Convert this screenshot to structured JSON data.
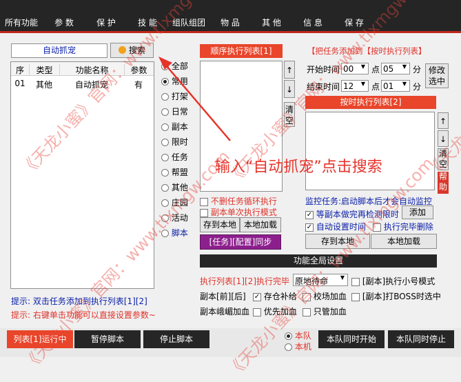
{
  "nav": {
    "tabs": [
      "所有功能",
      "参 数",
      "保 护",
      "技 能",
      "组队组团",
      "物 品",
      "其 他",
      "信 息",
      "保 存"
    ],
    "active_index": 0
  },
  "search": {
    "value": "自动抓宠",
    "button_label": "搜索"
  },
  "table": {
    "headers": [
      "序",
      "类型",
      "功能名称",
      "参数"
    ],
    "rows": [
      [
        "01",
        "其他",
        "自动抓宠",
        "有"
      ]
    ]
  },
  "categories": [
    "全部",
    "常用",
    "打架",
    "日常",
    "副本",
    "限时",
    "任务",
    "帮盟",
    "其他",
    "庄园",
    "活动",
    "脚本"
  ],
  "categories_selected": "常用",
  "seq_list": {
    "title": "顺序执行列表[1]",
    "up": "↑",
    "down": "↓",
    "clear": "清空",
    "chk_no_delete": "不删任务循环执行",
    "chk_single": "副本单次执行模式",
    "save_local": "存到本地",
    "load_local": "本地加载",
    "sync": "[任务][配置]同步"
  },
  "timed": {
    "hint": "【把任务添加到【按时执行列表】",
    "start_label": "开始时间",
    "end_label": "结束时间",
    "start_hour": "00",
    "start_min": "05",
    "end_hour": "12",
    "end_min": "01",
    "point": "点",
    "minute": "分",
    "modify": "修改选中",
    "title": "按时执行列表[2]",
    "clear": "清空",
    "help": "帮助"
  },
  "monitor": {
    "label": "监控任务:启动脚本后才会自动监控",
    "chk_wait": "等副本做完再检测限时",
    "add": "添加",
    "chk_auto_time": "自动设置时间",
    "chk_delete": "执行完毕删除",
    "save_local": "存到本地",
    "load_local": "本地加载"
  },
  "global": {
    "title": "功能全局设置",
    "after_label": "执行列表[1][2]执行完毕",
    "after_value": "原地待命",
    "chk_small": "[副本]执行小号模式",
    "fb_label": "副本[前][后]",
    "chk_storage": "存仓补给",
    "chk_school": "校场加血",
    "chk_boss": "[副本]打BOSS时选中",
    "blood_label": "副本峨嵋加血",
    "chk_priority": "优先加血",
    "chk_only": "只管加血"
  },
  "tips": {
    "tip1": "提示: 双击任务添加到执行列表[1][2]",
    "tip2": "提示: 右键单击功能可以直接设置参数~"
  },
  "bottom": {
    "run": "列表[1]运行中",
    "pause": "暂停脚本",
    "stop": "停止脚本",
    "radio_team": "本队",
    "radio_local": "本机",
    "team_start": "本队同时开始",
    "team_stop": "本队同时停止"
  },
  "annotation": "输入“自动抓宠”点击搜索",
  "watermarks": [
    "《天龙小蜜》官网：www.tlxmgw.com",
    "《天龙小蜜》官网：www.tlxmgw.com",
    "《天龙小蜜》官网：www.tlxmgw.com",
    "《天龙小蜜》官网：www.tlxmgw.com",
    "《天龙小蜜》官网：www.tlxmgw.com"
  ],
  "colors": {
    "accent_red": "#e8452a",
    "nav_bg": "#252525",
    "annotation_red": "#e6332a",
    "tip_blue": "#0b20a8"
  }
}
